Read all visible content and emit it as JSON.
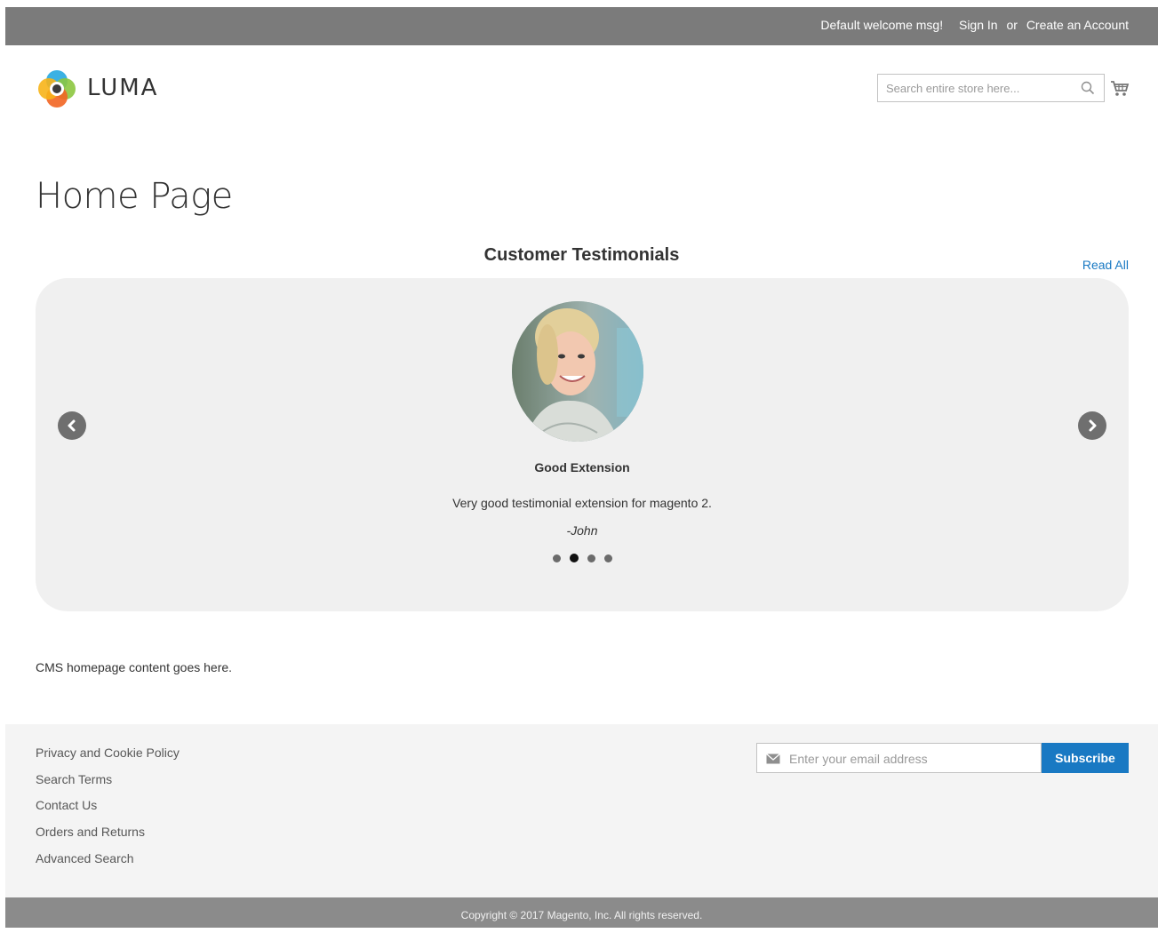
{
  "header": {
    "welcome": "Default welcome msg!",
    "sign_in": "Sign In",
    "separator": "or",
    "create_account": "Create an Account"
  },
  "logo": {
    "text": "LUMA"
  },
  "search": {
    "placeholder": "Search entire store here...",
    "value": ""
  },
  "icons": {
    "logo": "luma-logo-icon",
    "search": "search-icon",
    "cart": "cart-icon",
    "prev": "chevron-left-icon",
    "next": "chevron-right-icon",
    "mail": "envelope-icon"
  },
  "page": {
    "title": "Home Page"
  },
  "testimonials": {
    "heading": "Customer Testimonials",
    "read_all": "Read All",
    "current": {
      "title": "Good Extension",
      "text": "Very good testimonial extension for magento 2.",
      "author": "-John"
    },
    "slide_count": 4,
    "active_slide": 2
  },
  "cms": {
    "content": "CMS homepage content goes here."
  },
  "footer": {
    "links": [
      "Privacy and Cookie Policy",
      "Search Terms",
      "Contact Us",
      "Orders and Returns",
      "Advanced Search"
    ],
    "newsletter": {
      "placeholder": "Enter your email address",
      "value": "",
      "button": "Subscribe"
    },
    "copyright": "Copyright © 2017 Magento, Inc. All rights reserved."
  },
  "colors": {
    "topbar": "#7b7b7b",
    "accent": "#1979c3",
    "slider_bg": "#f0f0f0",
    "footer_bg": "#f4f4f4",
    "copyright_bg": "#8b8b8b"
  }
}
